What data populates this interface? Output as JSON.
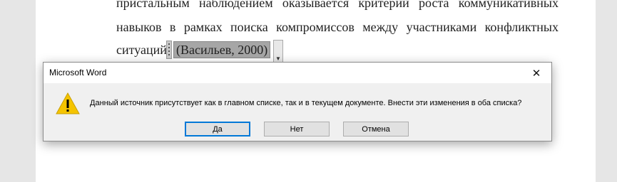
{
  "document": {
    "line1": "пристальным наблюдением оказывается критерий роста коммуникативных",
    "line2": "навыков в рамках поиска компромиссов между участниками конфликтных",
    "line3": "ситуаций",
    "citation": "(Васильев, 2000)"
  },
  "dialog": {
    "title": "Microsoft Word",
    "close_glyph": "✕",
    "message": "Данный источник присутствует как в главном списке, так и в текущем документе. Внести эти изменения в оба списка?",
    "icon": "warning-icon",
    "buttons": {
      "yes": "Да",
      "no": "Нет",
      "cancel": "Отмена"
    }
  },
  "colors": {
    "warning_fill": "#f5c400",
    "default_button_border": "#0078d7",
    "citation_highlight": "#a6a6a6"
  }
}
